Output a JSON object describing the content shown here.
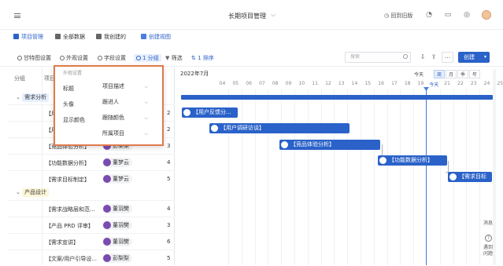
{
  "header": {
    "title": "长期项目管理",
    "home_label": "回到旧版"
  },
  "view_tabs": [
    {
      "label": "项目管理"
    },
    {
      "label": "全部数据"
    },
    {
      "label": "我创建的"
    },
    {
      "label": "创建视图"
    }
  ],
  "toolbar": {
    "gantt_settings": "甘特图设置",
    "appearance": "外观设置",
    "field_settings": "字段设置",
    "group": "1 分组",
    "filter": "筛选",
    "sort": "1 排序",
    "search_placeholder": "搜索",
    "create": "创建"
  },
  "table": {
    "col_group": "分组",
    "col_item": "项目",
    "groups": [
      {
        "label": "需求分析",
        "rows": [
          {
            "title": "【用户反馈分...",
            "person": "",
            "count": "2"
          },
          {
            "title": "【用户调研访...",
            "person": "",
            "count": "2"
          },
          {
            "title": "【竞品体验分析】",
            "person": "彭梨梨",
            "count": "3"
          },
          {
            "title": "【功能数据分析】",
            "person": "董梦云",
            "count": "4"
          },
          {
            "title": "【需求目标制定】",
            "person": "董梦云",
            "count": "5"
          }
        ]
      },
      {
        "label": "产品设计",
        "rows": [
          {
            "title": "【需求战略层和范...",
            "person": "董羽樊",
            "count": "4"
          },
          {
            "title": "【产品 PRD 评审】",
            "person": "董羽樊",
            "count": "3"
          },
          {
            "title": "【需求宣讲】",
            "person": "董羽樊",
            "count": "6"
          },
          {
            "title": "【文案/用户引导设...",
            "person": "彭梨梨",
            "count": "5"
          }
        ]
      }
    ]
  },
  "gantt": {
    "month": "2022年7月",
    "today_btn": "今天",
    "scale": [
      "周",
      "月",
      "季",
      "年"
    ],
    "days": [
      "04",
      "05",
      "06",
      "07",
      "08",
      "09",
      "10",
      "11",
      "12",
      "13",
      "14",
      "15",
      "16",
      "17",
      "18",
      "19",
      "今天",
      "21",
      "22",
      "23",
      "24",
      "25"
    ],
    "bars": [
      {
        "label": "【用户反馈分..."
      },
      {
        "label": "【用户调研访谈】"
      },
      {
        "label": "【竞品体验分析】"
      },
      {
        "label": "【功能数据分析】"
      },
      {
        "label": "【需求目标"
      }
    ]
  },
  "popup": {
    "title": "外观设置",
    "rows": [
      {
        "label": "标题",
        "value": "项目描述"
      },
      {
        "label": "头像",
        "value": "跟进人"
      },
      {
        "label": "显示颜色",
        "value": "跟随颜色"
      },
      {
        "label": "",
        "value": "所属项目"
      }
    ]
  },
  "right_rail": {
    "item1": "消息",
    "item2": "遇到问题"
  },
  "colors": {
    "accent": "#2a62c9",
    "popup_border": "#e07a4b",
    "today_line": "#4a7ee0"
  }
}
